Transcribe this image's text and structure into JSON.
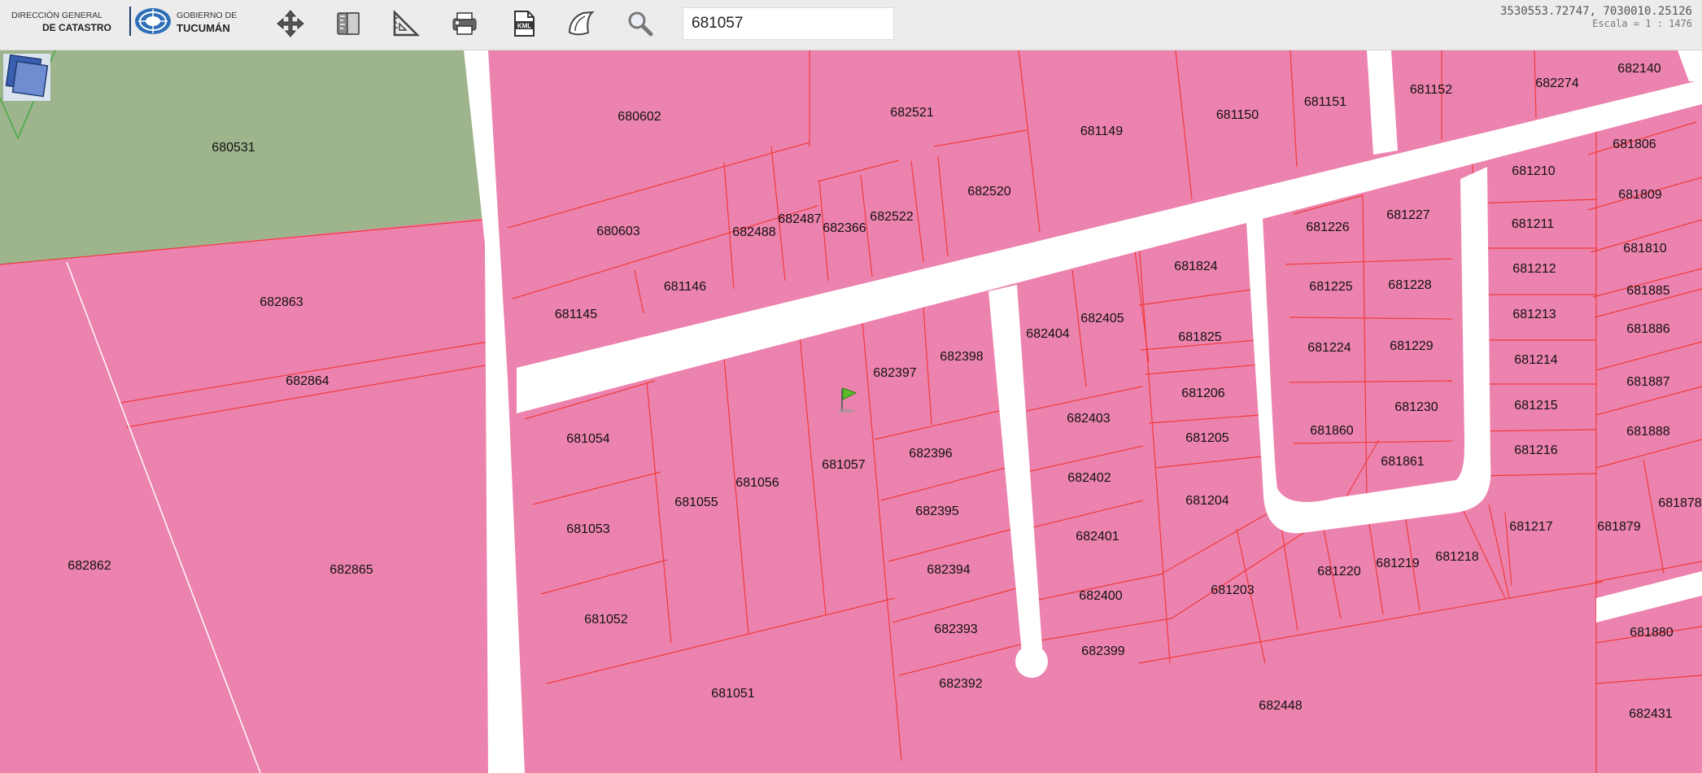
{
  "header": {
    "logo_left_top": "DIRECCIÓN GENERAL",
    "logo_left_bottom": "DE CATASTRO",
    "logo_right_top": "GOBIERNO DE",
    "logo_right_bottom": "TUCUMÁN"
  },
  "toolbar": {
    "tools": [
      {
        "icon": "pan-move-icon"
      },
      {
        "icon": "measure-ruler-icon"
      },
      {
        "icon": "measure-area-icon"
      },
      {
        "icon": "print-icon"
      },
      {
        "icon": "export-kml-icon"
      },
      {
        "icon": "map-layers-icon"
      },
      {
        "icon": "search-magnifier-icon"
      }
    ],
    "kml_label": "KML"
  },
  "search": {
    "value": "681057",
    "placeholder": ""
  },
  "status": {
    "coordinates": "3530553.72747, 7030010.25126",
    "scale": "Escala = 1 : 1476"
  },
  "map": {
    "colors": {
      "parcel_fill": "#ec83ae",
      "parcel_border": "#ef3b3b",
      "road": "#ffffff",
      "green_area": "#9db48c",
      "green_border": "#44aa44"
    },
    "selected_parcel": "681057",
    "parcels": [
      "680531",
      "680602",
      "682521",
      "681149",
      "681150",
      "681151",
      "681152",
      "682274",
      "682140",
      "680603",
      "682488",
      "682487",
      "682366",
      "682522",
      "682520",
      "681146",
      "681145",
      "682863",
      "682864",
      "682862",
      "682865",
      "681806",
      "681809",
      "681810",
      "681885",
      "681886",
      "681887",
      "681888",
      "681878",
      "681879",
      "681880",
      "682431",
      "681210",
      "681211",
      "681212",
      "681213",
      "681214",
      "681215",
      "681216",
      "681217",
      "681226",
      "681227",
      "681225",
      "681228",
      "681224",
      "681229",
      "681860",
      "681230",
      "681861",
      "681824",
      "681825",
      "681206",
      "681205",
      "681204",
      "681203",
      "681220",
      "681219",
      "681218",
      "682404",
      "682405",
      "682403",
      "682402",
      "682401",
      "682400",
      "682399",
      "682398",
      "682397",
      "682396",
      "682395",
      "682394",
      "682393",
      "682392",
      "681054",
      "681055",
      "681056",
      "681057",
      "681053",
      "681052",
      "681051",
      "682448"
    ]
  }
}
